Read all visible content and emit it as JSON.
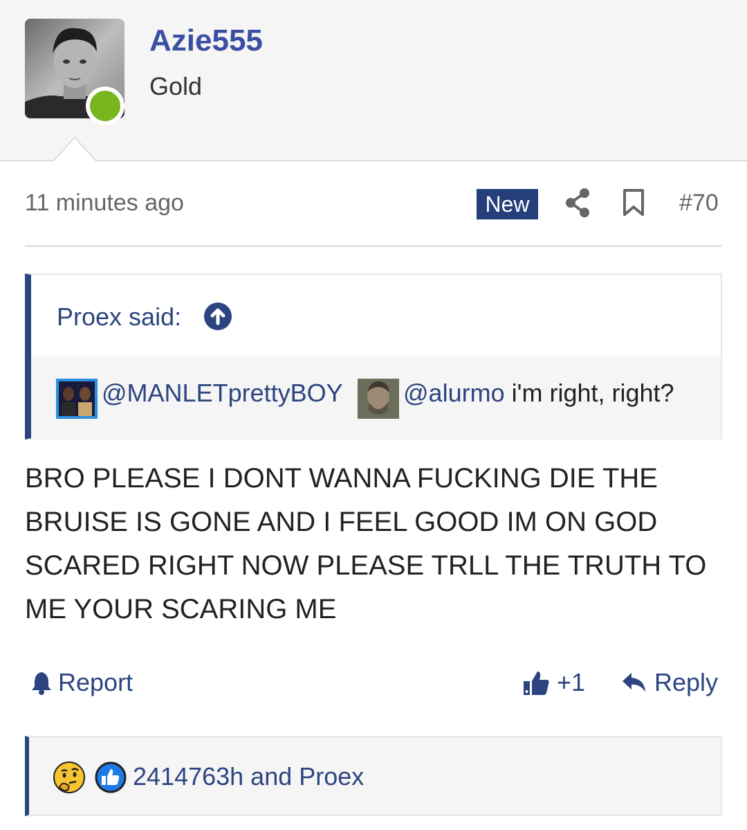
{
  "user": {
    "username": "Azie555",
    "title": "Gold"
  },
  "post": {
    "timestamp": "11 minutes ago",
    "badge": "New",
    "number": "#70",
    "message": "BRO PLEASE I DONT WANNA FUCKING DIE THE BRUISE IS GONE AND I FEEL GOOD IM ON GOD SCARED RIGHT NOW PLEASE TRLL THE TRUTH TO ME YOUR SCARING ME"
  },
  "quote": {
    "author": "Proex said:",
    "mention_1": "@MANLETprettyBOY",
    "mention_2": "@alurmo",
    "text": " i'm right, right?"
  },
  "actions": {
    "report": "Report",
    "like_count": "+1",
    "reply": "Reply"
  },
  "reactions": {
    "summary": "2414763h and Proex"
  },
  "colors": {
    "accent": "#2c4480",
    "username": "#3a4fa3",
    "online": "#79b51c",
    "badge_bg": "#243f7a"
  },
  "icons": {
    "share": "share-icon",
    "bookmark": "bookmark-icon",
    "quote_up": "arrow-up-circle-icon",
    "report": "bell-icon",
    "like": "thumbs-up-icon",
    "reply": "reply-arrow-icon",
    "reaction_1": "thinking-face-icon",
    "reaction_2": "like-reaction-icon"
  }
}
